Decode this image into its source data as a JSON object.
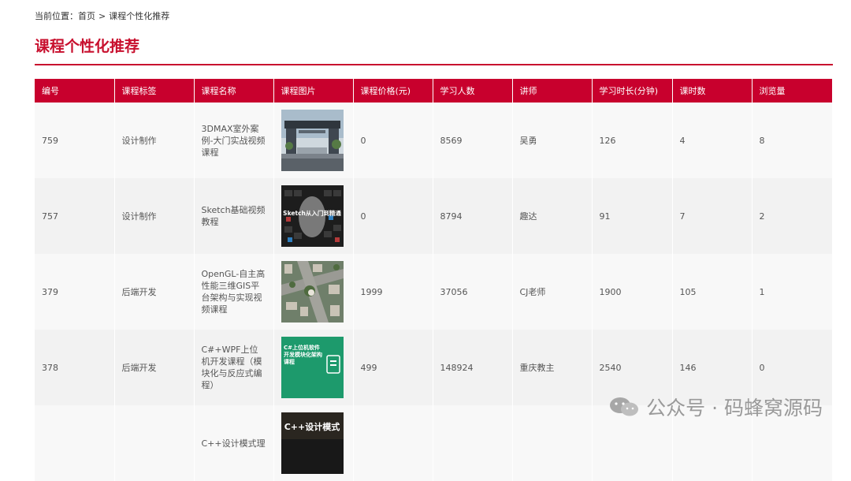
{
  "breadcrumb": {
    "prefix": "当前位置：",
    "home": "首页",
    "separator": ">",
    "current": "课程个性化推荐"
  },
  "page": {
    "title": "课程个性化推荐"
  },
  "table": {
    "columns": [
      "编号",
      "课程标签",
      "课程名称",
      "课程图片",
      "课程价格(元)",
      "学习人数",
      "讲师",
      "学习时长(分钟)",
      "课时数",
      "浏览量"
    ],
    "rows": [
      {
        "id": "759",
        "tag": "设计制作",
        "name": "3DMAX室外案例-大门实战视频课程",
        "image": "gate-building-thumbnail",
        "price": "0",
        "students": "8569",
        "teacher": "吴勇",
        "duration": "126",
        "lessons": "4",
        "views": "8"
      },
      {
        "id": "757",
        "tag": "设计制作",
        "name": "Sketch基础视频教程",
        "image": "sketch-course-thumbnail",
        "image_text": "Sketch从入门到精通",
        "price": "0",
        "students": "8794",
        "teacher": "趣达",
        "duration": "91",
        "lessons": "7",
        "views": "2"
      },
      {
        "id": "379",
        "tag": "后端开发",
        "name": "OpenGL-自主高性能三维GIS平台架构与实现视频课程",
        "image": "city-3d-gis-thumbnail",
        "price": "1999",
        "students": "37056",
        "teacher": "CJ老师",
        "duration": "1900",
        "lessons": "105",
        "views": "1"
      },
      {
        "id": "378",
        "tag": "后端开发",
        "name": "C#+WPF上位机开发课程（模块化与反应式编程）",
        "image": "csharp-wpf-thumbnail",
        "image_text": "C#上位机软件开发模块化架构课程",
        "price": "499",
        "students": "148924",
        "teacher": "重庆教主",
        "duration": "2540",
        "lessons": "146",
        "views": "0"
      },
      {
        "id": "",
        "tag": "",
        "name": "C++设计模式理",
        "image": "cpp-design-pattern-thumbnail",
        "image_text": "C++设计模式",
        "price": "",
        "students": "",
        "teacher": "",
        "duration": "",
        "lessons": "",
        "views": ""
      }
    ]
  },
  "watermark": {
    "text": "公众号 · 码蜂窝源码",
    "icon": "wechat-icon"
  },
  "colors": {
    "accent": "#c8102e",
    "header_bg": "#c8002d"
  }
}
